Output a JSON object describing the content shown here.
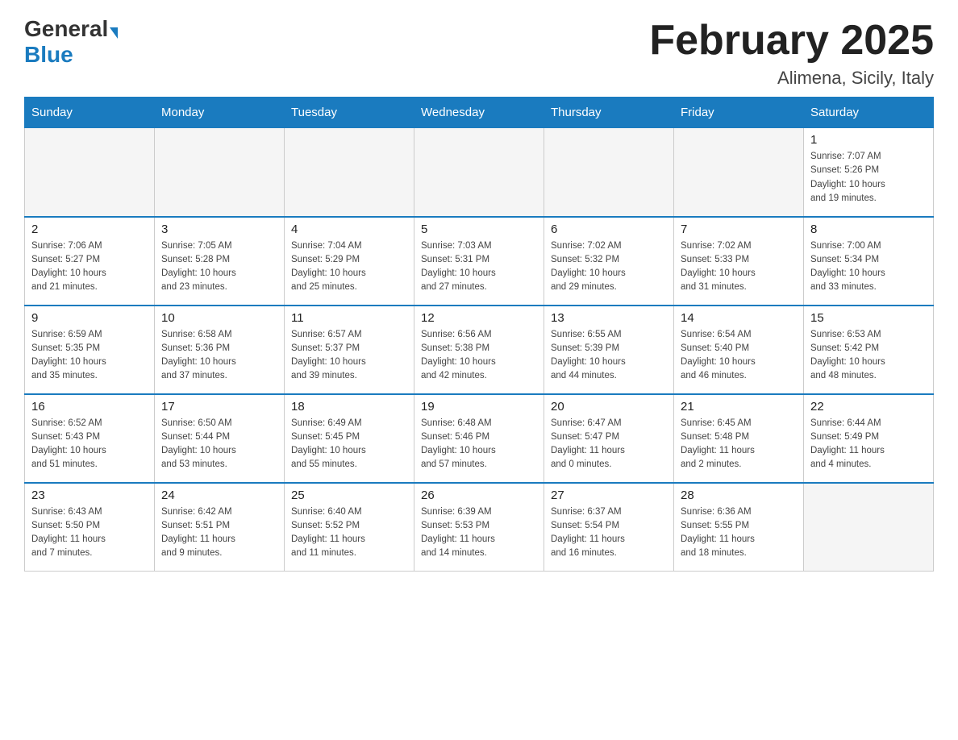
{
  "logo": {
    "general": "General",
    "blue": "Blue"
  },
  "title": "February 2025",
  "location": "Alimena, Sicily, Italy",
  "weekdays": [
    "Sunday",
    "Monday",
    "Tuesday",
    "Wednesday",
    "Thursday",
    "Friday",
    "Saturday"
  ],
  "weeks": [
    [
      {
        "day": "",
        "info": ""
      },
      {
        "day": "",
        "info": ""
      },
      {
        "day": "",
        "info": ""
      },
      {
        "day": "",
        "info": ""
      },
      {
        "day": "",
        "info": ""
      },
      {
        "day": "",
        "info": ""
      },
      {
        "day": "1",
        "info": "Sunrise: 7:07 AM\nSunset: 5:26 PM\nDaylight: 10 hours\nand 19 minutes."
      }
    ],
    [
      {
        "day": "2",
        "info": "Sunrise: 7:06 AM\nSunset: 5:27 PM\nDaylight: 10 hours\nand 21 minutes."
      },
      {
        "day": "3",
        "info": "Sunrise: 7:05 AM\nSunset: 5:28 PM\nDaylight: 10 hours\nand 23 minutes."
      },
      {
        "day": "4",
        "info": "Sunrise: 7:04 AM\nSunset: 5:29 PM\nDaylight: 10 hours\nand 25 minutes."
      },
      {
        "day": "5",
        "info": "Sunrise: 7:03 AM\nSunset: 5:31 PM\nDaylight: 10 hours\nand 27 minutes."
      },
      {
        "day": "6",
        "info": "Sunrise: 7:02 AM\nSunset: 5:32 PM\nDaylight: 10 hours\nand 29 minutes."
      },
      {
        "day": "7",
        "info": "Sunrise: 7:02 AM\nSunset: 5:33 PM\nDaylight: 10 hours\nand 31 minutes."
      },
      {
        "day": "8",
        "info": "Sunrise: 7:00 AM\nSunset: 5:34 PM\nDaylight: 10 hours\nand 33 minutes."
      }
    ],
    [
      {
        "day": "9",
        "info": "Sunrise: 6:59 AM\nSunset: 5:35 PM\nDaylight: 10 hours\nand 35 minutes."
      },
      {
        "day": "10",
        "info": "Sunrise: 6:58 AM\nSunset: 5:36 PM\nDaylight: 10 hours\nand 37 minutes."
      },
      {
        "day": "11",
        "info": "Sunrise: 6:57 AM\nSunset: 5:37 PM\nDaylight: 10 hours\nand 39 minutes."
      },
      {
        "day": "12",
        "info": "Sunrise: 6:56 AM\nSunset: 5:38 PM\nDaylight: 10 hours\nand 42 minutes."
      },
      {
        "day": "13",
        "info": "Sunrise: 6:55 AM\nSunset: 5:39 PM\nDaylight: 10 hours\nand 44 minutes."
      },
      {
        "day": "14",
        "info": "Sunrise: 6:54 AM\nSunset: 5:40 PM\nDaylight: 10 hours\nand 46 minutes."
      },
      {
        "day": "15",
        "info": "Sunrise: 6:53 AM\nSunset: 5:42 PM\nDaylight: 10 hours\nand 48 minutes."
      }
    ],
    [
      {
        "day": "16",
        "info": "Sunrise: 6:52 AM\nSunset: 5:43 PM\nDaylight: 10 hours\nand 51 minutes."
      },
      {
        "day": "17",
        "info": "Sunrise: 6:50 AM\nSunset: 5:44 PM\nDaylight: 10 hours\nand 53 minutes."
      },
      {
        "day": "18",
        "info": "Sunrise: 6:49 AM\nSunset: 5:45 PM\nDaylight: 10 hours\nand 55 minutes."
      },
      {
        "day": "19",
        "info": "Sunrise: 6:48 AM\nSunset: 5:46 PM\nDaylight: 10 hours\nand 57 minutes."
      },
      {
        "day": "20",
        "info": "Sunrise: 6:47 AM\nSunset: 5:47 PM\nDaylight: 11 hours\nand 0 minutes."
      },
      {
        "day": "21",
        "info": "Sunrise: 6:45 AM\nSunset: 5:48 PM\nDaylight: 11 hours\nand 2 minutes."
      },
      {
        "day": "22",
        "info": "Sunrise: 6:44 AM\nSunset: 5:49 PM\nDaylight: 11 hours\nand 4 minutes."
      }
    ],
    [
      {
        "day": "23",
        "info": "Sunrise: 6:43 AM\nSunset: 5:50 PM\nDaylight: 11 hours\nand 7 minutes."
      },
      {
        "day": "24",
        "info": "Sunrise: 6:42 AM\nSunset: 5:51 PM\nDaylight: 11 hours\nand 9 minutes."
      },
      {
        "day": "25",
        "info": "Sunrise: 6:40 AM\nSunset: 5:52 PM\nDaylight: 11 hours\nand 11 minutes."
      },
      {
        "day": "26",
        "info": "Sunrise: 6:39 AM\nSunset: 5:53 PM\nDaylight: 11 hours\nand 14 minutes."
      },
      {
        "day": "27",
        "info": "Sunrise: 6:37 AM\nSunset: 5:54 PM\nDaylight: 11 hours\nand 16 minutes."
      },
      {
        "day": "28",
        "info": "Sunrise: 6:36 AM\nSunset: 5:55 PM\nDaylight: 11 hours\nand 18 minutes."
      },
      {
        "day": "",
        "info": ""
      }
    ]
  ]
}
